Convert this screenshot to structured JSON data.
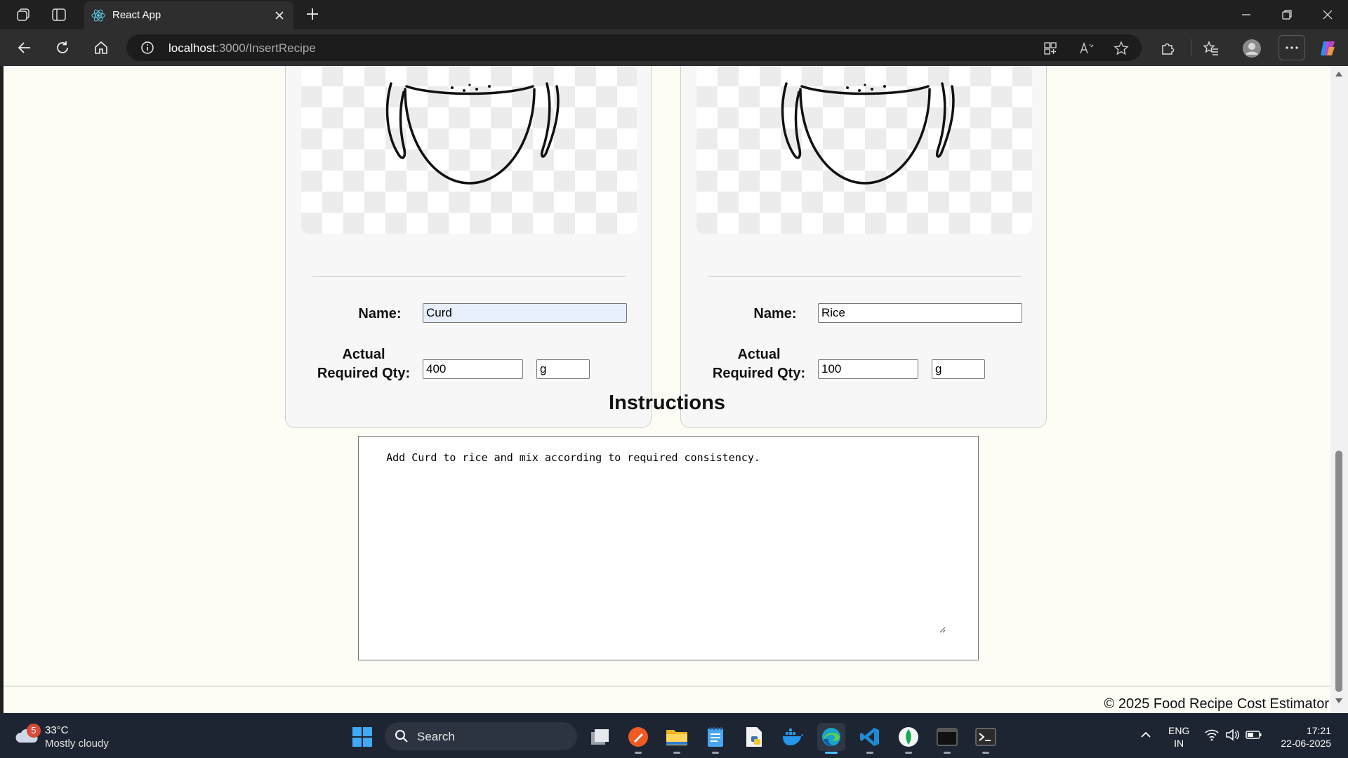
{
  "browser": {
    "tab_title": "React App",
    "url_host": "localhost",
    "url_path": ":3000/InsertRecipe"
  },
  "recipe": {
    "ingredients": [
      {
        "name_label": "Name:",
        "name_value": "Curd",
        "qty_label": "Actual Required Qty:",
        "qty_value": "400",
        "unit_value": "g"
      },
      {
        "name_label": "Name:",
        "name_value": "Rice",
        "qty_label": "Actual Required Qty:",
        "qty_value": "100",
        "unit_value": "g"
      }
    ],
    "instructions_heading": "Instructions",
    "instructions_text": "Add Curd to rice and mix according to required consistency."
  },
  "footer": {
    "text": "© 2025 Food Recipe Cost Estimator"
  },
  "taskbar": {
    "weather_badge": "5",
    "weather_temp": "33°C",
    "weather_condition": "Mostly cloudy",
    "search_label": "Search",
    "lang_line1": "ENG",
    "lang_line2": "IN",
    "time": "17:21",
    "date": "22-06-2025"
  },
  "colors": {
    "page_background": "#fdfdf5",
    "card_background": "#f7f7f7",
    "autofill_background": "#e8f0fe",
    "taskbar_background": "#1e2532",
    "edge_accent": "#4cc2ff"
  },
  "icons": [
    "workspaces-icon",
    "tab-actions-icon",
    "react-favicon-icon",
    "close-icon",
    "plus-icon",
    "back-icon",
    "refresh-icon",
    "home-icon",
    "info-icon",
    "app-available-icon",
    "read-aloud-icon",
    "favorite-star-icon",
    "extensions-icon",
    "favorites-icon",
    "profile-icon",
    "more-icon",
    "copilot-icon",
    "windows-start-icon",
    "search-icon"
  ]
}
